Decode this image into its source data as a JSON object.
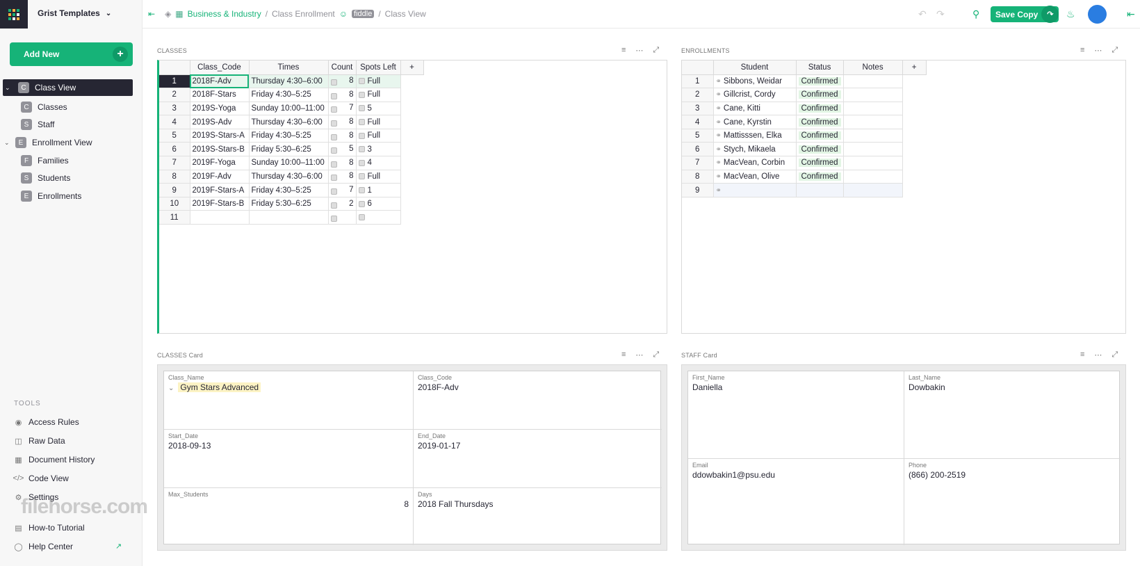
{
  "org": {
    "name": "Grist Templates"
  },
  "sidebar": {
    "add_new": "Add New",
    "pages": [
      {
        "initial": "C",
        "label": "Class View",
        "active": true,
        "caret": "⌄"
      },
      {
        "initial": "C",
        "label": "Classes"
      },
      {
        "initial": "S",
        "label": "Staff"
      },
      {
        "initial": "E",
        "label": "Enrollment View",
        "caret": "⌄"
      },
      {
        "initial": "F",
        "label": "Families"
      },
      {
        "initial": "S",
        "label": "Students"
      },
      {
        "initial": "E",
        "label": "Enrollments"
      }
    ],
    "tools_header": "TOOLS",
    "tools": [
      {
        "icon": "eye-icon",
        "label": "Access Rules"
      },
      {
        "icon": "database-icon",
        "label": "Raw Data"
      },
      {
        "icon": "history-icon",
        "label": "Document History"
      },
      {
        "icon": "code-icon",
        "label": "Code View"
      },
      {
        "icon": "gear-icon",
        "label": "Settings"
      },
      {
        "icon": "tutorial-icon",
        "label": "How-to Tutorial"
      },
      {
        "icon": "help-icon",
        "label": "Help Center"
      }
    ]
  },
  "breadcrumb": {
    "workspace": "Business & Industry",
    "sep": "/",
    "doc": "Class Enrollment",
    "mode": "fiddle",
    "page": "Class View"
  },
  "topbar": {
    "save_copy": "Save Copy"
  },
  "classes": {
    "title": "CLASSES",
    "columns": [
      "Class_Code",
      "Times",
      "Count",
      "Spots Left",
      "+"
    ],
    "rows": [
      [
        "1",
        "2018F-Adv",
        "Thursday 4:30–6:00",
        "8",
        "Full"
      ],
      [
        "2",
        "2018F-Stars",
        "Friday 4:30–5:25",
        "8",
        "Full"
      ],
      [
        "3",
        "2019S-Yoga",
        "Sunday 10:00–11:00",
        "7",
        "5"
      ],
      [
        "4",
        "2019S-Adv",
        "Thursday 4:30–6:00",
        "8",
        "Full"
      ],
      [
        "5",
        "2019S-Stars-A",
        "Friday 4:30–5:25",
        "8",
        "Full"
      ],
      [
        "6",
        "2019S-Stars-B",
        "Friday 5:30–6:25",
        "5",
        "3"
      ],
      [
        "7",
        "2019F-Yoga",
        "Sunday 10:00–11:00",
        "8",
        "4"
      ],
      [
        "8",
        "2019F-Adv",
        "Thursday 4:30–6:00",
        "8",
        "Full"
      ],
      [
        "9",
        "2019F-Stars-A",
        "Friday 4:30–5:25",
        "7",
        "1"
      ],
      [
        "10",
        "2019F-Stars-B",
        "Friday 5:30–6:25",
        "2",
        "6"
      ],
      [
        "11",
        "",
        "",
        "",
        ""
      ]
    ]
  },
  "enrollments": {
    "title": "ENROLLMENTS",
    "columns": [
      "Student",
      "Status",
      "Notes",
      "+"
    ],
    "rows": [
      [
        "1",
        "Sibbons, Weidar",
        "Confirmed",
        ""
      ],
      [
        "2",
        "Gillcrist, Cordy",
        "Confirmed",
        ""
      ],
      [
        "3",
        "Cane, Kitti",
        "Confirmed",
        ""
      ],
      [
        "4",
        "Cane, Kyrstin",
        "Confirmed",
        ""
      ],
      [
        "5",
        "Mattisssen, Elka",
        "Confirmed",
        ""
      ],
      [
        "6",
        "Stych, Mikaela",
        "Confirmed",
        ""
      ],
      [
        "7",
        "MacVean, Corbin",
        "Confirmed",
        ""
      ],
      [
        "8",
        "MacVean, Olive",
        "Confirmed",
        ""
      ],
      [
        "9",
        "",
        "",
        ""
      ]
    ]
  },
  "classes_card": {
    "title": "CLASSES Card",
    "fields": [
      {
        "label": "Class_Name",
        "value": "Gym Stars Advanced"
      },
      {
        "label": "Class_Code",
        "value": "2018F-Adv"
      },
      {
        "label": "Start_Date",
        "value": "2018-09-13"
      },
      {
        "label": "End_Date",
        "value": "2019-01-17"
      },
      {
        "label": "Max_Students",
        "value": "8"
      },
      {
        "label": "Days",
        "value": "2018 Fall Thursdays"
      }
    ]
  },
  "staff_card": {
    "title": "STAFF Card",
    "fields": [
      {
        "label": "First_Name",
        "value": "Daniella"
      },
      {
        "label": "Last_Name",
        "value": "Dowbakin"
      },
      {
        "label": "Email",
        "value": "ddowbakin1@psu.edu"
      },
      {
        "label": "Phone",
        "value": "(866) 200-2519"
      }
    ]
  },
  "watermark": "filehorse.com"
}
